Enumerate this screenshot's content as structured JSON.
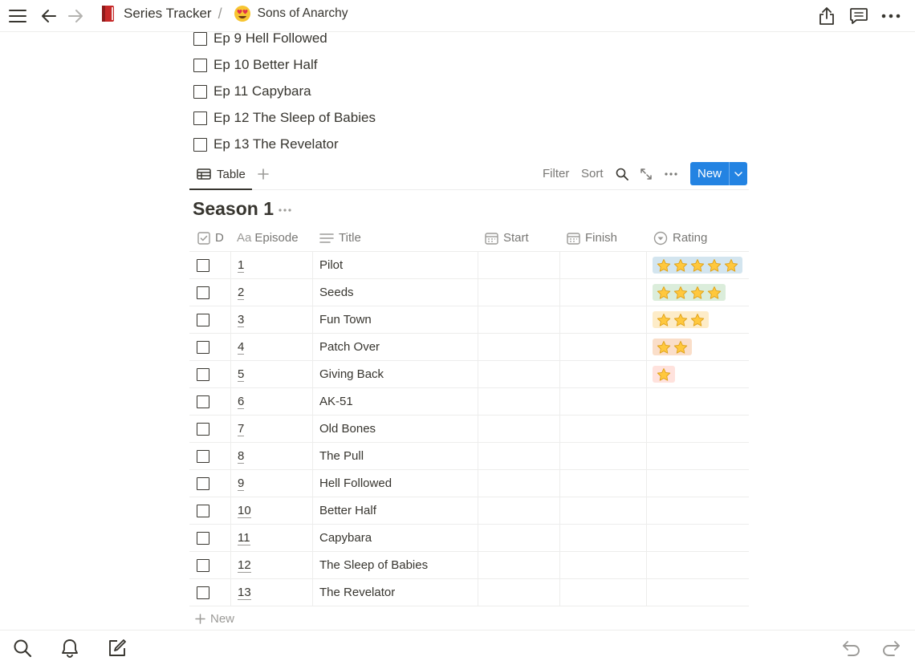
{
  "topbar": {
    "breadcrumb_root": "Series Tracker",
    "breadcrumb_sep": "/",
    "breadcrumb_page": "Sons of Anarchy",
    "icons": [
      "menu-icon",
      "back-arrow-icon",
      "forward-arrow-icon",
      "book-icon",
      "heart-eyes-emoji-icon",
      "share-icon",
      "comment-icon",
      "more-icon"
    ]
  },
  "todos": [
    {
      "label": "Ep 9 Hell Followed",
      "checked": false
    },
    {
      "label": "Ep 10 Better Half",
      "checked": false
    },
    {
      "label": "Ep 11 Capybara",
      "checked": false
    },
    {
      "label": "Ep 12 The Sleep of Babies",
      "checked": false
    },
    {
      "label": "Ep 13 The Revelator",
      "checked": false
    }
  ],
  "view": {
    "tab_label": "Table",
    "filter_label": "Filter",
    "sort_label": "Sort",
    "new_label": "New",
    "accent": "#2383e2"
  },
  "group": {
    "title": "Season 1"
  },
  "columns": {
    "done": "D",
    "episode": "Episode",
    "title": "Title",
    "start": "Start",
    "finish": "Finish",
    "rating": "Rating"
  },
  "rows": [
    {
      "done": false,
      "episode": "1",
      "title": "Pilot",
      "start": "",
      "finish": "",
      "rating": 5
    },
    {
      "done": false,
      "episode": "2",
      "title": "Seeds",
      "start": "",
      "finish": "",
      "rating": 4
    },
    {
      "done": false,
      "episode": "3",
      "title": "Fun Town",
      "start": "",
      "finish": "",
      "rating": 3
    },
    {
      "done": false,
      "episode": "4",
      "title": "Patch Over",
      "start": "",
      "finish": "",
      "rating": 2
    },
    {
      "done": false,
      "episode": "5",
      "title": "Giving Back",
      "start": "",
      "finish": "",
      "rating": 1
    },
    {
      "done": false,
      "episode": "6",
      "title": "AK-51",
      "start": "",
      "finish": "",
      "rating": 0
    },
    {
      "done": false,
      "episode": "7",
      "title": "Old Bones",
      "start": "",
      "finish": "",
      "rating": 0
    },
    {
      "done": false,
      "episode": "8",
      "title": "The Pull",
      "start": "",
      "finish": "",
      "rating": 0
    },
    {
      "done": false,
      "episode": "9",
      "title": "Hell Followed",
      "start": "",
      "finish": "",
      "rating": 0
    },
    {
      "done": false,
      "episode": "10",
      "title": "Better Half",
      "start": "",
      "finish": "",
      "rating": 0
    },
    {
      "done": false,
      "episode": "11",
      "title": "Capybara",
      "start": "",
      "finish": "",
      "rating": 0
    },
    {
      "done": false,
      "episode": "12",
      "title": "The Sleep of Babies",
      "start": "",
      "finish": "",
      "rating": 0
    },
    {
      "done": false,
      "episode": "13",
      "title": "The Revelator",
      "start": "",
      "finish": "",
      "rating": 0
    }
  ],
  "rating_colors": {
    "5": "#d3e5ef",
    "4": "#dbeddb",
    "3": "#fdecc8",
    "2": "#fadec9",
    "1": "#ffe2dd"
  },
  "add_row_label": "New",
  "bottombar": {
    "icons": [
      "search-icon",
      "bell-icon",
      "compose-icon",
      "undo-icon",
      "redo-icon"
    ]
  }
}
